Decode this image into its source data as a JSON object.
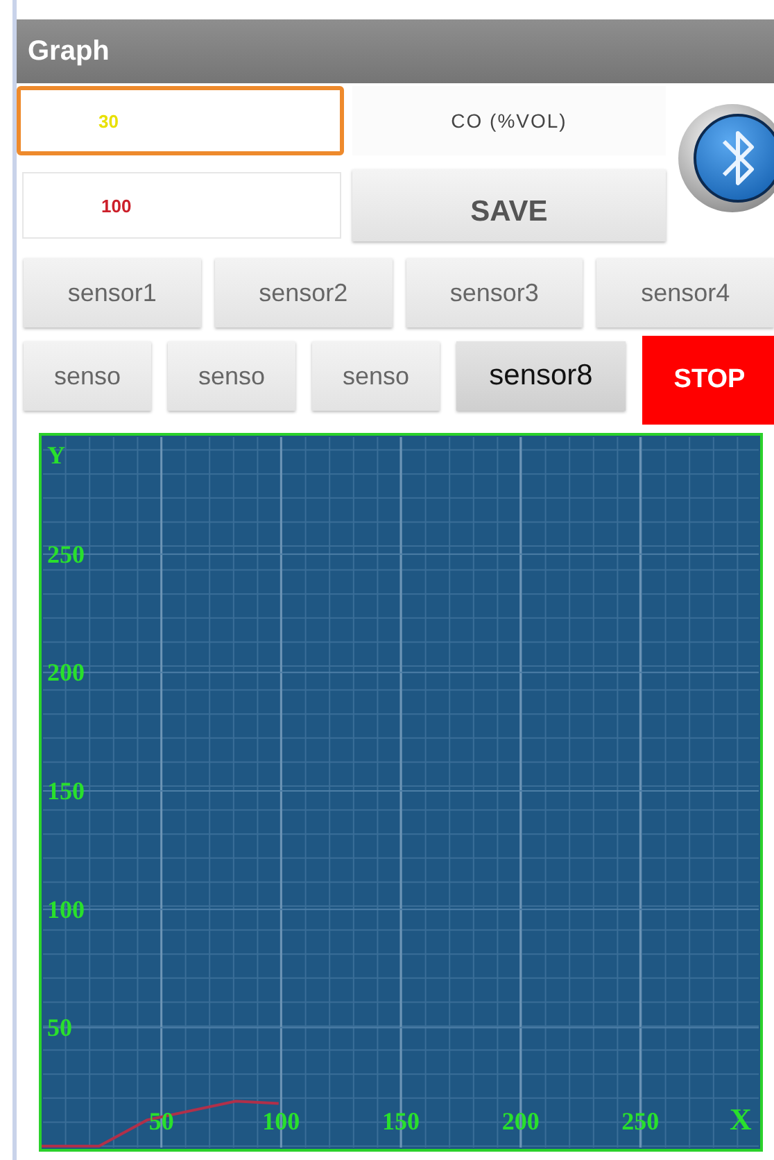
{
  "window": {
    "title": "Graph"
  },
  "fields": [
    {
      "value": "30",
      "color": "#e8e000",
      "focused": true
    },
    {
      "value": "100",
      "color": "#cc1f2a",
      "focused": false
    }
  ],
  "unit_label": "CO (%VOL)",
  "save_button": "SAVE",
  "sensor_rows": [
    [
      {
        "label": "sensor1",
        "kind": "sensor",
        "selected": false
      },
      {
        "label": "sensor2",
        "kind": "sensor",
        "selected": false
      },
      {
        "label": "sensor3",
        "kind": "sensor",
        "selected": false
      },
      {
        "label": "sensor4",
        "kind": "sensor",
        "selected": false
      }
    ],
    [
      {
        "label": "senso",
        "kind": "sensor",
        "selected": false
      },
      {
        "label": "senso",
        "kind": "sensor",
        "selected": false
      },
      {
        "label": "senso",
        "kind": "sensor",
        "selected": false
      },
      {
        "label": "sensor8",
        "kind": "sensor",
        "selected": true
      },
      {
        "label": "STOP",
        "kind": "stop"
      }
    ]
  ],
  "chart": {
    "chart_data": {
      "type": "line",
      "grid": true,
      "xlabel": "X",
      "ylabel": "Y",
      "xlim": [
        0,
        300
      ],
      "ylim": [
        0,
        300
      ],
      "xticks": [
        50,
        100,
        150,
        200,
        250
      ],
      "yticks": [
        50,
        100,
        150,
        200,
        250
      ],
      "x": [
        0,
        24,
        44,
        81,
        99
      ],
      "series": [
        {
          "color": "#b0304a",
          "values": [
            0,
            0,
            11,
            19,
            18
          ]
        }
      ]
    }
  }
}
